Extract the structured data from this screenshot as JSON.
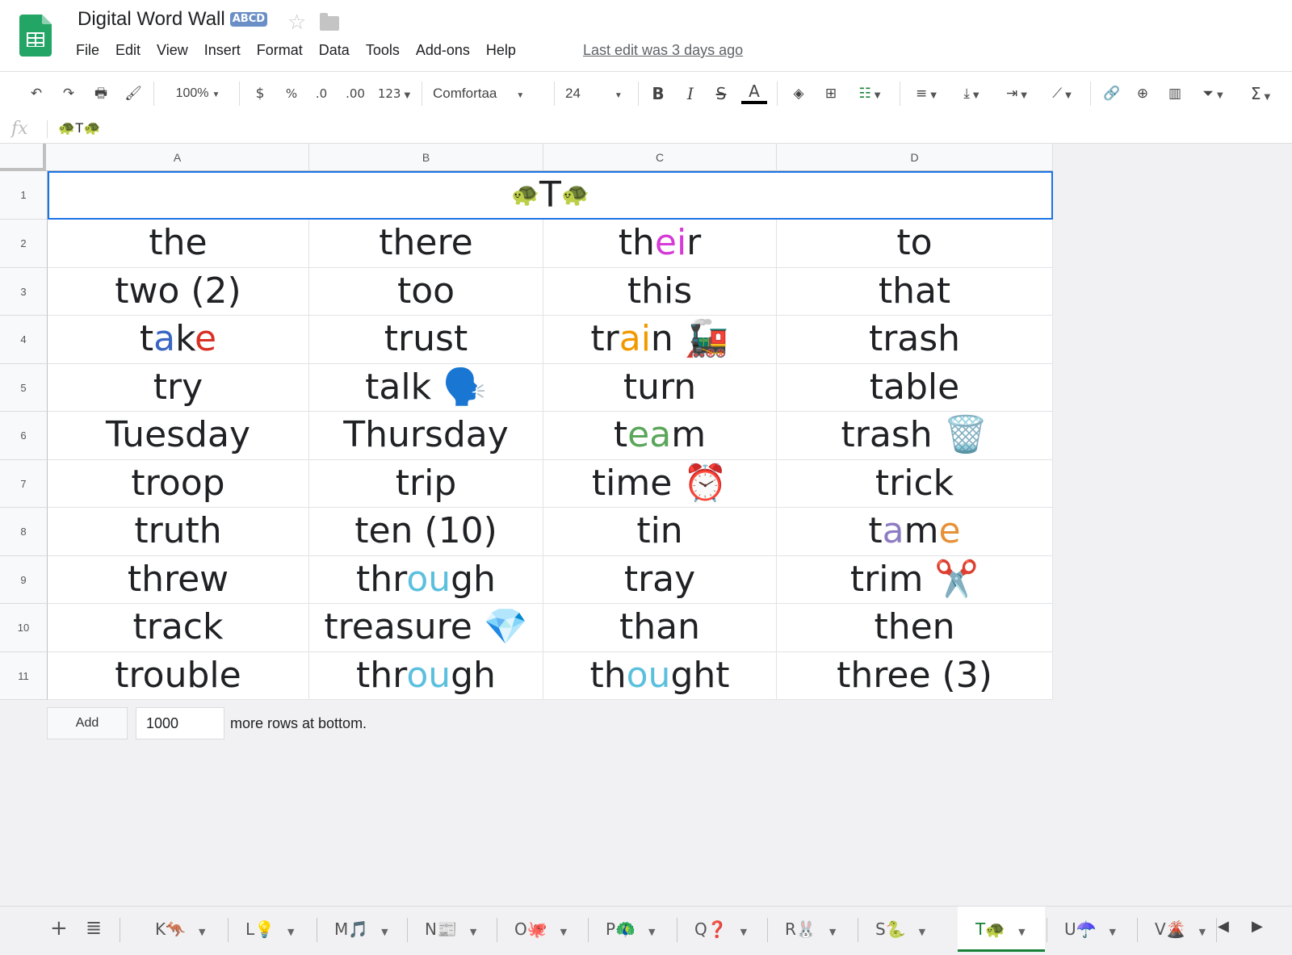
{
  "app": {
    "title": "Digital Word Wall",
    "title_emoji": "ABCD",
    "star_icon": "star-icon",
    "folder_icon": "folder-icon"
  },
  "menu": [
    "File",
    "Edit",
    "View",
    "Insert",
    "Format",
    "Data",
    "Tools",
    "Add-ons",
    "Help"
  ],
  "last_edit": "Last edit was 3 days ago",
  "toolbar": {
    "zoom": "100%",
    "currency": "$",
    "percent": "%",
    "decimal_decrease": ".0",
    "decimal_increase": ".00",
    "number_format": "123",
    "font": "Comfortaa",
    "font_size": "24",
    "bold": "B",
    "italic": "I",
    "strike": "S",
    "text_color": "A",
    "sum": "Σ"
  },
  "formula_bar": {
    "fx": "fx",
    "content": "🐢T🐢"
  },
  "columns": [
    "A",
    "B",
    "C",
    "D"
  ],
  "rows": [
    "1",
    "2",
    "3",
    "4",
    "5",
    "6",
    "7",
    "8",
    "9",
    "10",
    "11"
  ],
  "header_cell": {
    "emoji": "🐢",
    "letter": "T"
  },
  "words": [
    [
      "the",
      "there",
      "their",
      "to"
    ],
    [
      "two (2)",
      "too",
      "this",
      "that"
    ],
    [
      "take",
      "trust",
      "train 🚂",
      "trash"
    ],
    [
      "try",
      "talk 🗣️",
      "turn",
      "table"
    ],
    [
      "Tuesday",
      "Thursday",
      "team",
      "trash 🗑️"
    ],
    [
      "troop",
      "trip",
      "time ⏰",
      "trick"
    ],
    [
      "truth",
      "ten (10)",
      "tin",
      "tame"
    ],
    [
      "threw",
      "through",
      "tray",
      "trim ✂️"
    ],
    [
      "track",
      "treasure 💎",
      "than",
      "then"
    ],
    [
      "trouble",
      "through",
      "thought",
      "three (3)"
    ]
  ],
  "colored_words": {
    "their": {
      "start": "th",
      "color_part": "ei",
      "end": "r",
      "color": "#d63bd6"
    },
    "take": {
      "parts": [
        "t",
        "a",
        "k",
        "e"
      ],
      "colors": [
        "#202124",
        "#3b66c4",
        "#202124",
        "#d93025"
      ]
    },
    "train": {
      "start": "tr",
      "color_part": "ai",
      "end": "n",
      "color": "#f29900"
    },
    "team": {
      "start": "t",
      "color_part": "ea",
      "end": "m",
      "color": "#5aa65a"
    },
    "tame": {
      "parts": [
        "t",
        "a",
        "m",
        "e"
      ],
      "colors": [
        "#202124",
        "#8e7cc3",
        "#202124",
        "#e69138"
      ]
    },
    "through": {
      "start": "thr",
      "color_part": "ou",
      "end": "gh",
      "color": "#5bc0de"
    },
    "thought": {
      "start": "th",
      "color_part": "ou",
      "end": "ght",
      "color": "#5bc0de"
    }
  },
  "add_rows": {
    "button": "Add",
    "count": "1000",
    "label": "more rows at bottom."
  },
  "sheets": [
    {
      "label": "K🦘",
      "active": false
    },
    {
      "label": "L💡",
      "active": false
    },
    {
      "label": "M🎵",
      "active": false
    },
    {
      "label": "N📰",
      "active": false
    },
    {
      "label": "O🐙",
      "active": false
    },
    {
      "label": "P🦚",
      "active": false
    },
    {
      "label": "Q❓",
      "active": false
    },
    {
      "label": "R🐰",
      "active": false
    },
    {
      "label": "S🐍",
      "active": false
    },
    {
      "label": "T🐢",
      "active": true
    },
    {
      "label": "U☂️",
      "active": false
    },
    {
      "label": "V🌋",
      "active": false
    }
  ]
}
